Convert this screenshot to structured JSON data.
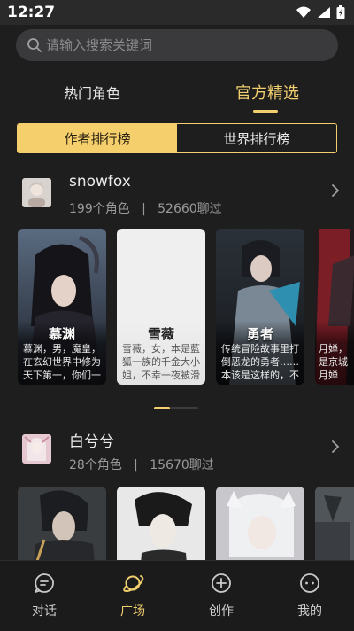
{
  "status_bar": {
    "time": "12:27"
  },
  "search": {
    "placeholder": "请输入搜索关键词"
  },
  "main_tabs": [
    {
      "label": "热门角色",
      "active": false
    },
    {
      "label": "官方精选",
      "active": true
    }
  ],
  "ranking_tabs": [
    {
      "label": "作者排行榜",
      "active": true
    },
    {
      "label": "世界排行榜",
      "active": false
    }
  ],
  "authors": [
    {
      "name": "snowfox",
      "stats": "199个角色   |   52660聊过",
      "characters": [
        {
          "name": "慕渊",
          "desc": "慕渊，男，魔皇，在玄幻世界中修为天下第一，你们一"
        },
        {
          "name": "雪薇",
          "desc": "雪薇，女，本是藍狐一族的千金大小姐，不幸一夜被滑"
        },
        {
          "name": "勇者",
          "desc": "传统冒险故事里打倒恶龙的勇者……本该是这样的，不"
        },
        {
          "name": "",
          "desc": "月婵，是京城月婵"
        }
      ]
    },
    {
      "name": "白兮兮",
      "stats": "28个角色   |   15670聊过",
      "characters": [
        {
          "name": "",
          "desc": ""
        },
        {
          "name": "",
          "desc": ""
        },
        {
          "name": "",
          "desc": ""
        },
        {
          "name": "",
          "desc": ""
        }
      ]
    }
  ],
  "bottom_nav": [
    {
      "label": "对话",
      "icon": "chat-icon",
      "active": false
    },
    {
      "label": "广场",
      "icon": "planet-icon",
      "active": true
    },
    {
      "label": "创作",
      "icon": "plus-circle-icon",
      "active": false
    },
    {
      "label": "我的",
      "icon": "profile-icon",
      "active": false
    }
  ],
  "colors": {
    "accent": "#f2cf6e",
    "background": "#1e1e1f",
    "search_bg": "#3a3a3c"
  }
}
